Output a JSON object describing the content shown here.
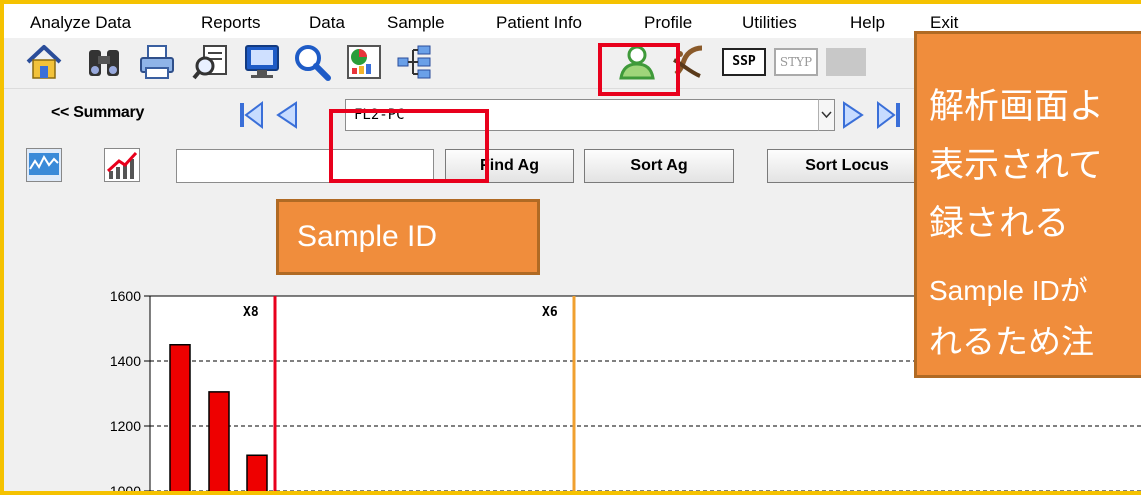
{
  "menubar": {
    "items": [
      "Analyze Data",
      "Reports",
      "Data",
      "Sample",
      "Patient Info",
      "Profile",
      "Utilities",
      "Help",
      "Exit"
    ]
  },
  "toolbar": {
    "icons": [
      "home-icon",
      "binoculars-icon",
      "printer-icon",
      "search-document-icon",
      "monitor-icon",
      "magnifier-icon",
      "report-chart-icon",
      "tree-diagram-icon",
      "patient-user-icon",
      "dna-icon",
      "ssp-icon",
      "styp-icon"
    ],
    "ssp_label": "SSP",
    "styp_label": "STYP"
  },
  "navbar": {
    "summary_label": "<< Summary",
    "sample_id_value": "FL2-PC"
  },
  "buttonbar": {
    "find_ag_label": "Find Ag",
    "sort_ag_label": "Sort Ag",
    "sort_locus_label": "Sort Locus"
  },
  "annotations": {
    "sample_id_callout": "Sample ID",
    "note_lines": [
      "解析画面よ",
      "表示されて",
      "録される",
      "Sample IDが",
      "れるため注"
    ]
  },
  "chart_data": {
    "type": "bar",
    "y_ticks": [
      1000,
      1200,
      1400,
      1600
    ],
    "ylim": [
      1000,
      1600
    ],
    "grid": "dashed horizontal",
    "bars": [
      {
        "value": 1450
      },
      {
        "value": 1305
      },
      {
        "value": 1110
      }
    ],
    "markers": [
      {
        "label": "X8",
        "color": "#e8001c"
      },
      {
        "label": "X6",
        "color": "#f0a030"
      }
    ],
    "bar_color": "#ee0000"
  },
  "colors": {
    "frame": "#f5c200",
    "highlight": "#e8001c",
    "callout": "#f08d3c",
    "nav_arrow": "#3a6fd8"
  }
}
